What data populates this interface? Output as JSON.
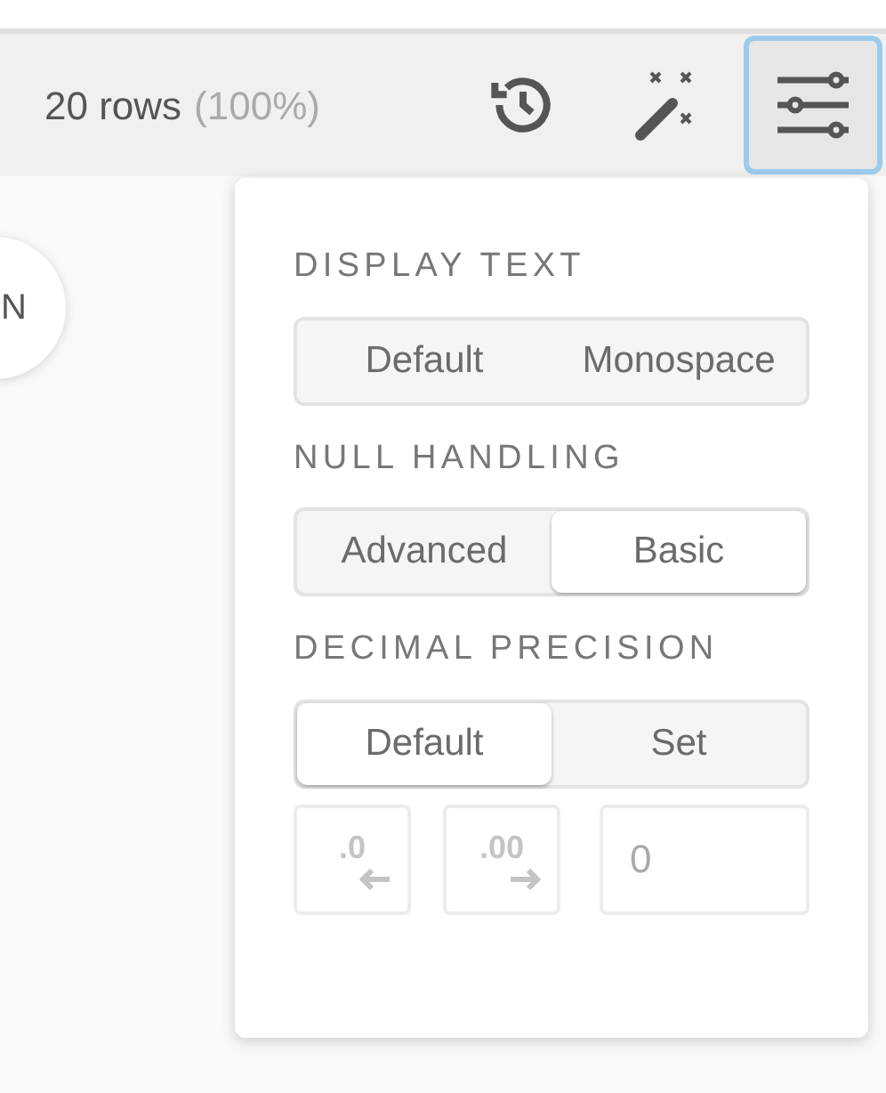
{
  "toolbar": {
    "row_count": "20 rows",
    "row_percent": "(100%)",
    "settings_active": true
  },
  "column_badge": {
    "label": "N"
  },
  "settings": {
    "sections": [
      {
        "title": "DISPLAY TEXT",
        "options": [
          {
            "label": "Default",
            "selected": false
          },
          {
            "label": "Monospace",
            "selected": false
          }
        ]
      },
      {
        "title": "NULL HANDLING",
        "options": [
          {
            "label": "Advanced",
            "selected": false
          },
          {
            "label": "Basic",
            "selected": true
          }
        ]
      },
      {
        "title": "DECIMAL PRECISION",
        "options": [
          {
            "label": "Default",
            "selected": true
          },
          {
            "label": "Set",
            "selected": false
          }
        ]
      }
    ],
    "precision_controls": {
      "decrease": {
        "label": ".0",
        "disabled": true
      },
      "increase": {
        "label": ".00",
        "disabled": true
      },
      "digits": {
        "placeholder": "0"
      }
    }
  }
}
